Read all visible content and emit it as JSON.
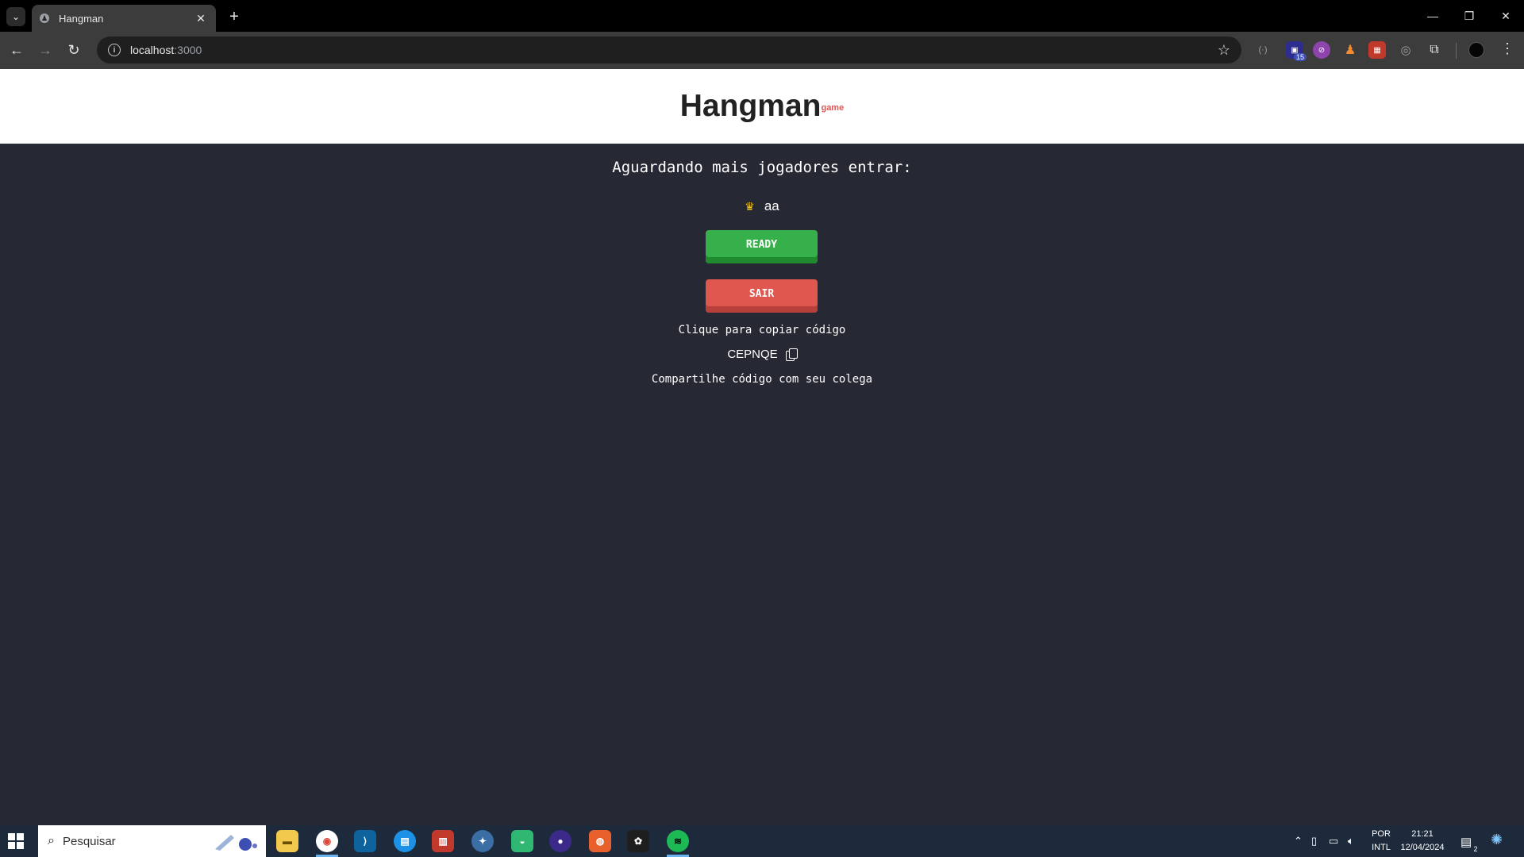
{
  "browser": {
    "tab": {
      "title": "Hangman"
    },
    "url": {
      "host": "localhost",
      "port": ":3000"
    },
    "extensions": {
      "badge_count": "15"
    }
  },
  "app": {
    "logo": {
      "title": "Hangman",
      "subtitle": "game"
    },
    "lobby": {
      "waiting_text": "Aguardando mais jogadores entrar:",
      "player_name": "aa",
      "ready_label": "READY",
      "exit_label": "SAIR",
      "copy_hint": "Clique para copiar código",
      "room_code": "CEPNQE",
      "share_hint": "Compartilhe código com seu colega"
    },
    "colors": {
      "background": "#262833",
      "ready": "#35b04a",
      "exit": "#e0574f",
      "logo_subtitle": "#e05555"
    }
  },
  "taskbar": {
    "search_placeholder": "Pesquisar",
    "lang_line1": "POR",
    "lang_line2": "INTL",
    "time": "21:21",
    "date": "12/04/2024",
    "notification_count": "2"
  }
}
